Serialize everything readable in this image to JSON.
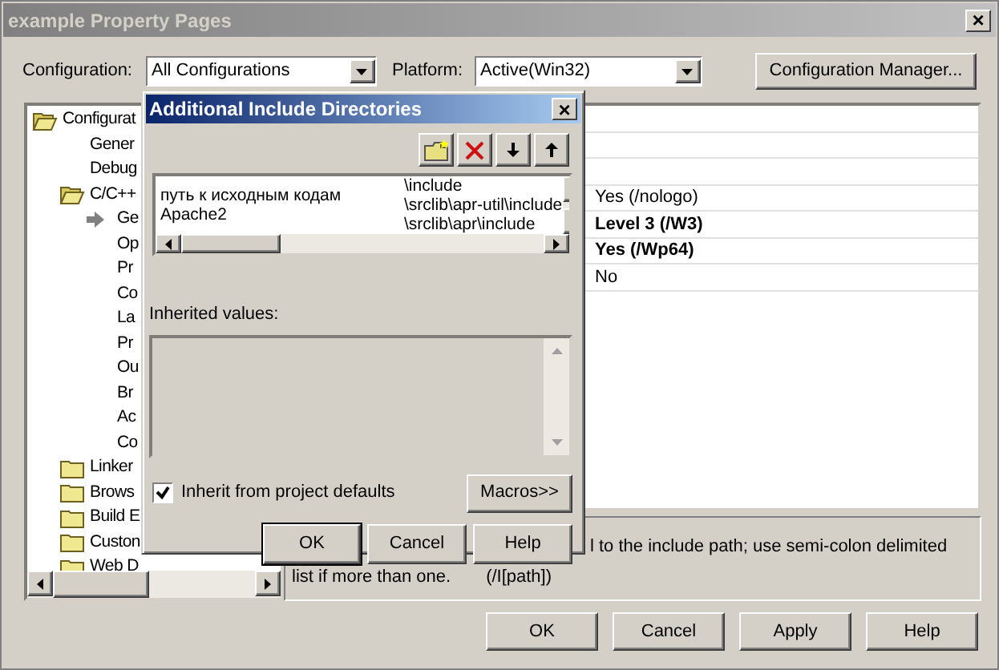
{
  "window": {
    "title": "example Property Pages",
    "close": "×"
  },
  "config_bar": {
    "configuration_label": "Configuration:",
    "configuration": "All Configurations",
    "platform_label": "Platform:",
    "platform": "Active(Win32)",
    "manager_button": "Configuration Manager..."
  },
  "tree": [
    {
      "label": "Configurat",
      "kind": "folder",
      "expanded": true,
      "children": [
        {
          "label": "Gener",
          "kind": "page",
          "current": false
        },
        {
          "label": "Debug",
          "kind": "page",
          "current": false
        },
        {
          "label": "C/C++",
          "kind": "folder",
          "expanded": true,
          "children": [
            {
              "label": "Ge",
              "kind": "page",
              "current": true
            },
            {
              "label": "Op",
              "kind": "page",
              "current": false
            },
            {
              "label": "Pr",
              "kind": "page",
              "current": false
            },
            {
              "label": "Co",
              "kind": "page",
              "current": false
            },
            {
              "label": "La",
              "kind": "page",
              "current": false
            },
            {
              "label": "Pr",
              "kind": "page",
              "current": false
            },
            {
              "label": "Ou",
              "kind": "page",
              "current": false
            },
            {
              "label": "Br",
              "kind": "page",
              "current": false
            },
            {
              "label": "Ac",
              "kind": "page",
              "current": false
            },
            {
              "label": "Co",
              "kind": "page",
              "current": false
            }
          ]
        },
        {
          "label": "Linker",
          "kind": "folder",
          "expanded": false
        },
        {
          "label": "Brows",
          "kind": "folder",
          "expanded": false
        },
        {
          "label": "Build E",
          "kind": "folder",
          "expanded": false
        },
        {
          "label": "Custon",
          "kind": "folder",
          "expanded": false
        },
        {
          "label": "Web D",
          "kind": "folder",
          "expanded": false
        }
      ]
    }
  ],
  "properties": [
    {
      "kind": "blank"
    },
    {
      "kind": "blank"
    },
    {
      "kind": "blank"
    },
    {
      "kind": "value",
      "value": "Yes (/nologo)",
      "bold": false
    },
    {
      "kind": "value",
      "value": "Level 3 (/W3)",
      "bold": true
    },
    {
      "kind": "value",
      "value": "Yes (/Wp64)",
      "bold": true
    },
    {
      "kind": "value",
      "value": "No",
      "bold": false
    }
  ],
  "description": {
    "line_1": "l to the include path; use semi-colon delimited",
    "line_2": "list if more than one.",
    "switch": "(/I[path])"
  },
  "buttons": [
    "OK",
    "Cancel",
    "Apply",
    "Help"
  ],
  "dialog": {
    "title": "Additional Include Directories",
    "close": "×",
    "note": [
      "путь к исходным кодам",
      "Apache2"
    ],
    "directories": [
      "\\include",
      "\\srclib\\apr-util\\include",
      "\\srclib\\apr\\include"
    ],
    "inherited_label": "Inherited values:",
    "inherit_checkbox": {
      "label": "Inherit from project defaults",
      "checked": true
    },
    "macros_button": "Macros>>",
    "buttons": [
      "OK",
      "Cancel",
      "Help"
    ]
  }
}
